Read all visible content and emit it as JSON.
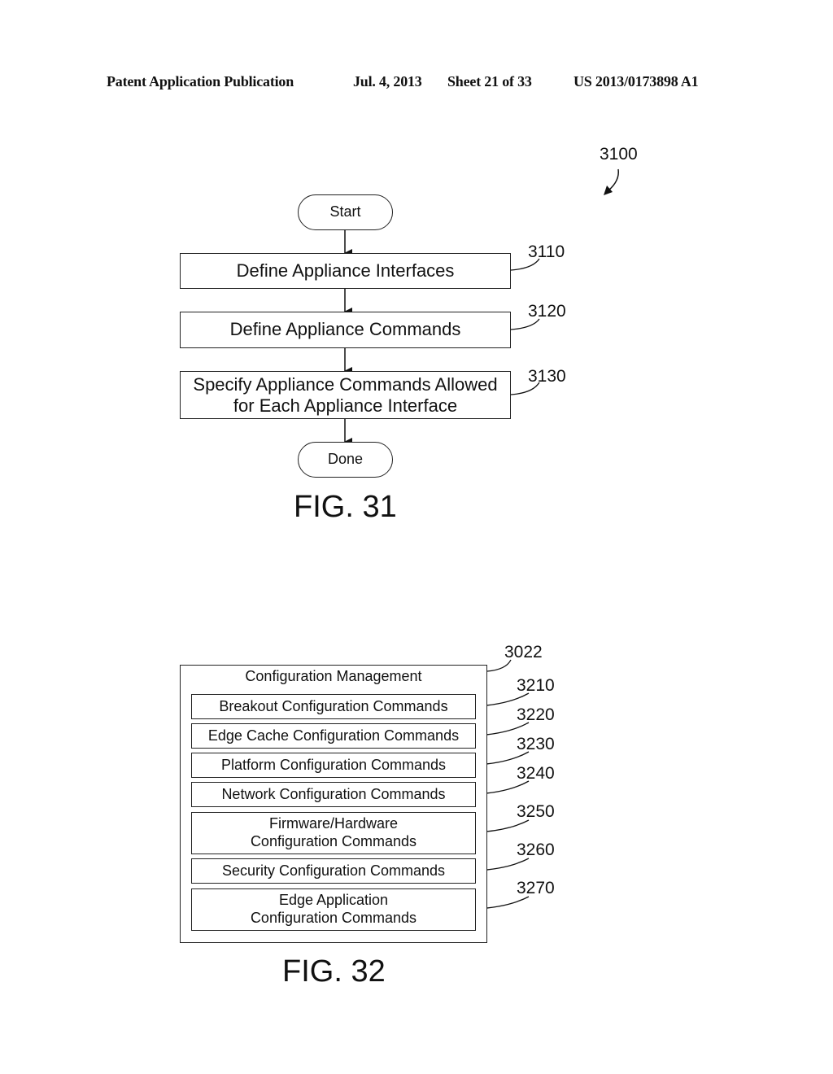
{
  "header": {
    "publication": "Patent Application Publication",
    "date": "Jul. 4, 2013",
    "sheet": "Sheet 21 of 33",
    "number": "US 2013/0173898 A1"
  },
  "fig31": {
    "ref": "3100",
    "start": "Start",
    "steps": [
      {
        "ref": "3110",
        "line1": "Define Appliance Interfaces",
        "line2": ""
      },
      {
        "ref": "3120",
        "line1": "Define Appliance Commands",
        "line2": ""
      },
      {
        "ref": "3130",
        "line1": "Specify Appliance Commands Allowed",
        "line2": "for Each Appliance Interface"
      }
    ],
    "done": "Done",
    "label": "FIG. 31"
  },
  "fig32": {
    "ref": "3022",
    "title": "Configuration Management",
    "items": [
      {
        "ref": "3210",
        "line1": "Breakout Configuration Commands",
        "line2": ""
      },
      {
        "ref": "3220",
        "line1": "Edge Cache Configuration Commands",
        "line2": ""
      },
      {
        "ref": "3230",
        "line1": "Platform Configuration Commands",
        "line2": ""
      },
      {
        "ref": "3240",
        "line1": "Network Configuration Commands",
        "line2": ""
      },
      {
        "ref": "3250",
        "line1": "Firmware/Hardware",
        "line2": "Configuration Commands"
      },
      {
        "ref": "3260",
        "line1": "Security Configuration Commands",
        "line2": ""
      },
      {
        "ref": "3270",
        "line1": "Edge Application",
        "line2": "Configuration Commands"
      }
    ],
    "label": "FIG. 32"
  }
}
